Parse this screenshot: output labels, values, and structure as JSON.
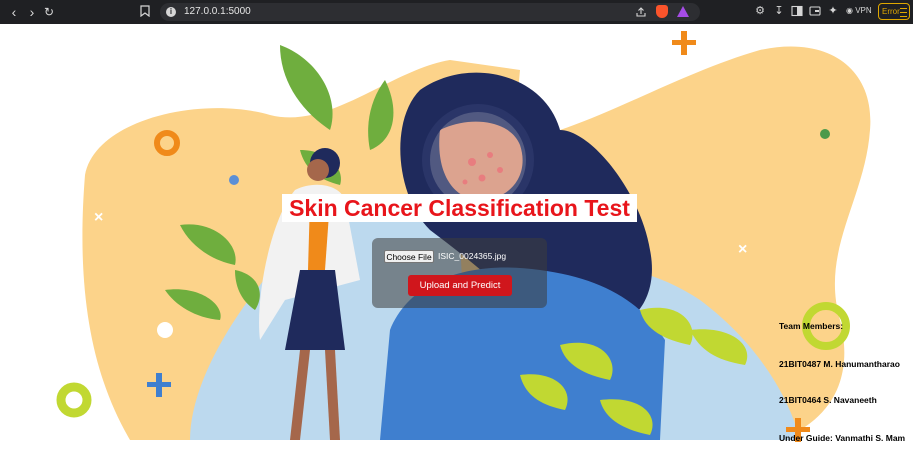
{
  "browser": {
    "url": "127.0.0.1:5000",
    "vpn_label": "VPN",
    "error_label": "Error"
  },
  "page": {
    "title": "Skin Cancer Classification Test",
    "choose_file_label": "Choose File",
    "file_name": "ISIC_0024365.jpg",
    "submit_label": "Upload and Predict",
    "team_heading": "Team Members:",
    "member_1": "21BIT0487 M. Hanumantharao",
    "member_2": "21BIT0464 S. Navaneeth",
    "guide": "Under Guide: Vanmathi S. Mam"
  },
  "colors": {
    "title_red": "#e8151b",
    "button_red": "#d0161c",
    "blob_yellow": "#fcd38a",
    "leaf_green": "#6fae3e",
    "hair_navy": "#1f2a5c",
    "shirt_blue": "#3f7fcf"
  },
  "icons": [
    "back-icon",
    "forward-icon",
    "reload-icon",
    "bookmark-icon",
    "site-info-icon",
    "share-icon",
    "brave-shields-icon",
    "brave-rewards-icon",
    "extensions-icon",
    "downloads-icon",
    "sidebar-icon",
    "wallet-icon",
    "leo-icon",
    "vpn-icon",
    "menu-icon"
  ]
}
